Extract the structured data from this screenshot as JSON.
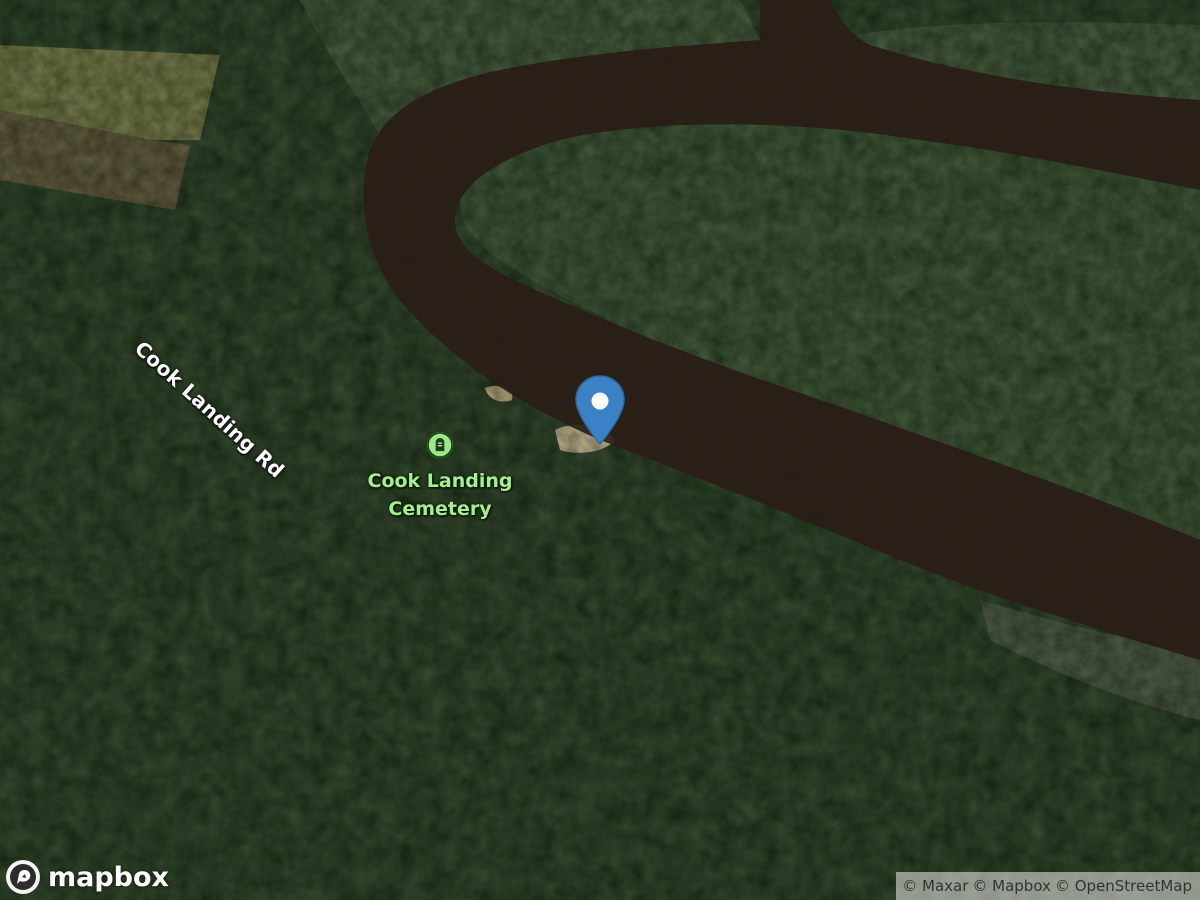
{
  "map": {
    "style": "satellite",
    "accent_colors": {
      "river": "#2b2019",
      "forest": "#263d20",
      "marsh": "#3f5535",
      "field": "#6f7440",
      "poi_label": "#a6ef90",
      "pin": "#3b82c4"
    }
  },
  "labels": {
    "road": "Cook Landing Rd",
    "poi_name_line1": "Cook Landing",
    "poi_name_line2": "Cemetery",
    "poi_icon": "cemetery-icon"
  },
  "marker": {
    "icon": "location-pin-icon",
    "color": "#3b82c4"
  },
  "branding": {
    "logo_text": "mapbox",
    "logo_icon": "mapbox-logo-icon"
  },
  "attribution": {
    "maxar": "© Maxar",
    "mapbox": "© Mapbox",
    "osm": "© OpenStreetMap"
  }
}
